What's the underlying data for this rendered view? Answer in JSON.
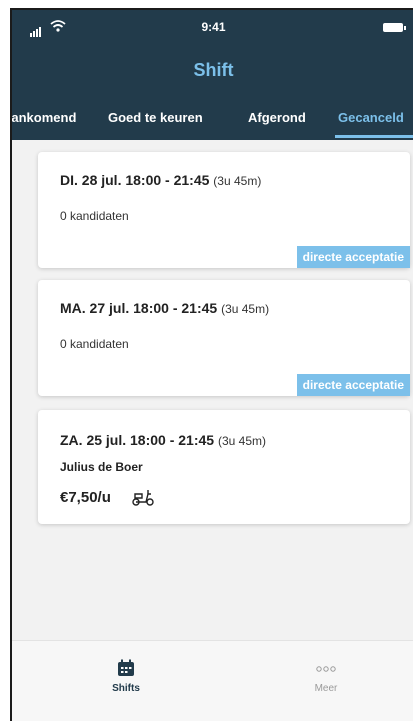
{
  "status_bar": {
    "time": "9:41"
  },
  "header": {
    "title": "Shift"
  },
  "tabs": [
    {
      "label": "Aankomend"
    },
    {
      "label": "Goed te keuren"
    },
    {
      "label": "Afgerond"
    },
    {
      "label": "Gecanceld"
    }
  ],
  "cards": [
    {
      "date": "DI. 28 jul. 18:00 - 21:45",
      "duration": "(3u 45m)",
      "subtitle": "0 kandidaten",
      "badge": "directe acceptatie"
    },
    {
      "date": "MA. 27 jul. 18:00 - 21:45",
      "duration": "(3u 45m)",
      "subtitle": "0 kandidaten",
      "badge": "directe acceptatie"
    },
    {
      "date": "ZA. 25 jul. 18:00 - 21:45",
      "duration": "(3u 45m)",
      "name": "Julius de Boer",
      "rate": "€7,50/u",
      "rate_icon": "scooter-icon"
    }
  ],
  "nav": [
    {
      "label": "Shifts",
      "icon": "calendar-icon"
    },
    {
      "label": "Meer",
      "icon": "more-icon"
    }
  ],
  "colors": {
    "header_bg": "#223b4b",
    "accent": "#7cc0ea",
    "background": "#f2f2f2"
  }
}
